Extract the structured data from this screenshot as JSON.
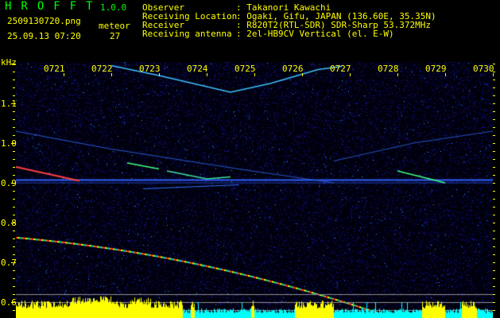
{
  "header": {
    "app_name": "HROFFT",
    "version": "1.0.0",
    "filename": "2509130720.png",
    "datetime": "25.09.13 07:20",
    "meteor_label": "meteor",
    "meteor_count": "27",
    "fields": [
      {
        "label": "Observer",
        "value": ": Takanori Kawachi"
      },
      {
        "label": "Receiving Location",
        "value": ": Ogaki, Gifu, JAPAN (136.60E, 35.35N)"
      },
      {
        "label": "Receiver",
        "value": ": R820T2(RTL-SDR) SDR-Sharp 53.372MHz"
      },
      {
        "label": "Receiving antenna",
        "value": ": 2el-HB9CV Vertical (el. E-W)"
      }
    ]
  },
  "spectrogram": {
    "y_unit": "kHz",
    "y_ticks": [
      "1.1",
      "1.0",
      "0.9",
      "0.8",
      "0.7",
      "0.6"
    ],
    "x_ticks": [
      "0721",
      "0722",
      "0723",
      "0724",
      "0725",
      "0726",
      "0727",
      "0728",
      "0729",
      "0730"
    ],
    "colors": {
      "text": "#ffff00",
      "logo": "#00ff00",
      "background": "#000010",
      "histogram_high": "#ffff00",
      "histogram_low": "#00ffff"
    }
  }
}
